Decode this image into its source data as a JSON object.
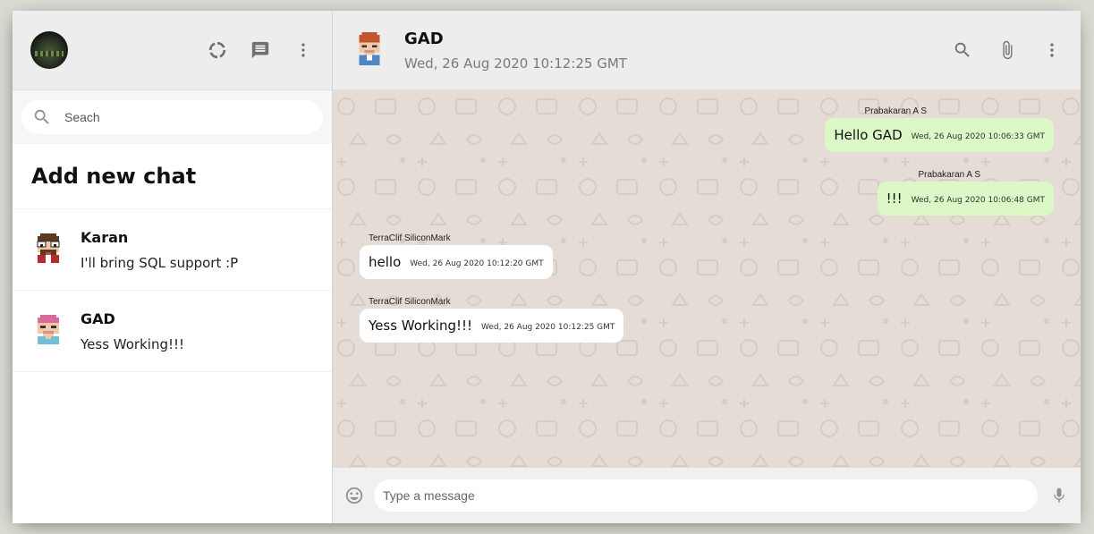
{
  "sidebar": {
    "header_icons": [
      "status-icon",
      "new-chat-icon",
      "more-vert-icon"
    ],
    "search_placeholder": "Seach",
    "add_new_chat": "Add new chat",
    "chats": [
      {
        "name": "Karan",
        "last_message": "I'll bring SQL support :P",
        "avatar_icon": "karan-pixel-avatar-icon"
      },
      {
        "name": "GAD",
        "last_message": "Yess Working!!!",
        "avatar_icon": "gad-pixel-avatar-icon"
      }
    ]
  },
  "chat": {
    "header": {
      "name": "GAD",
      "last_seen": "Wed, 26 Aug 2020 10:12:25 GMT",
      "icons": [
        "search-icon",
        "attach-icon",
        "more-vert-icon"
      ]
    },
    "messages": [
      {
        "sender": "Prabakaran A S",
        "text": "Hello GAD",
        "timestamp": "Wed, 26 Aug 2020 10:06:33 GMT",
        "direction": "sent"
      },
      {
        "sender": "Prabakaran A S",
        "text": "!!!",
        "timestamp": "Wed, 26 Aug 2020 10:06:48 GMT",
        "direction": "sent"
      },
      {
        "sender": "TerraClif SiliconMark",
        "text": "hello",
        "timestamp": "Wed, 26 Aug 2020 10:12:20 GMT",
        "direction": "received"
      },
      {
        "sender": "TerraClif SiliconMark",
        "text": "Yess Working!!!",
        "timestamp": "Wed, 26 Aug 2020 10:12:25 GMT",
        "direction": "received"
      }
    ],
    "footer": {
      "input_placeholder": "Type a message",
      "icons": [
        "emoji-icon",
        "mic-icon"
      ]
    }
  },
  "colors": {
    "sent_bubble": "#dcf8c6",
    "received_bubble": "#ffffff",
    "chat_background": "#e5ddd5",
    "header_background": "#ededed"
  }
}
